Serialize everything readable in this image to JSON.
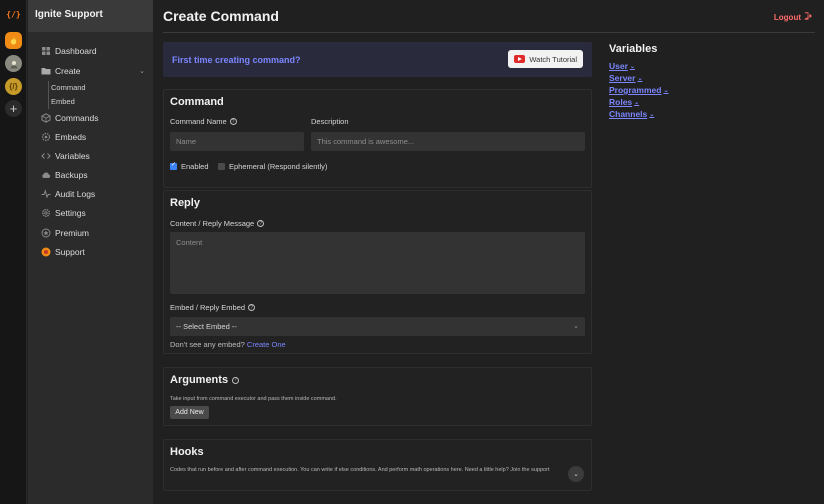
{
  "rail": {
    "logo": "{/}",
    "server3_label": "{/}",
    "add_label": "+"
  },
  "sidebar": {
    "server_name": "Ignite Support",
    "items": [
      {
        "label": "Dashboard",
        "icon": "grid-icon"
      },
      {
        "label": "Create",
        "icon": "folder-icon"
      },
      {
        "label": "Commands",
        "icon": "cube-icon"
      },
      {
        "label": "Embeds",
        "icon": "cog-icon"
      },
      {
        "label": "Variables",
        "icon": "code-icon"
      },
      {
        "label": "Backups",
        "icon": "cloud-icon"
      },
      {
        "label": "Audit Logs",
        "icon": "pulse-icon"
      },
      {
        "label": "Settings",
        "icon": "gear-icon"
      },
      {
        "label": "Premium",
        "icon": "star-icon"
      },
      {
        "label": "Support",
        "icon": "support-icon"
      }
    ],
    "create_sub": [
      "Command",
      "Embed"
    ],
    "chevron": "⌄"
  },
  "header": {
    "title": "Create Command",
    "logout": "Logout"
  },
  "banner": {
    "message": "First time creating command?",
    "button": "Watch Tutorial"
  },
  "command": {
    "heading": "Command",
    "name_label": "Command Name",
    "name_placeholder": "Name",
    "desc_label": "Description",
    "desc_placeholder": "This command is awesome...",
    "enabled_label": "Enabled",
    "enabled": true,
    "ephemeral_label": "Ephemeral (Respond silently)",
    "ephemeral": false
  },
  "reply": {
    "heading": "Reply",
    "content_label": "Content / Reply Message",
    "content_placeholder": "Content",
    "embed_label": "Embed / Reply Embed",
    "embed_selected": "-- Select Embed --",
    "hint_prefix": "Don't see any embed?",
    "hint_link": "Create One"
  },
  "arguments": {
    "heading": "Arguments",
    "description": "Take input from command executor and pass them inside command.",
    "add_button": "Add New"
  },
  "hooks": {
    "heading": "Hooks",
    "description": "Codes that run before and after command execution. You can write if else conditions. And perform math operations here. Need a little help? Join the support"
  },
  "variables": {
    "heading": "Variables",
    "items": [
      "User",
      "Server",
      "Programmed",
      "Roles",
      "Channels"
    ]
  },
  "colors": {
    "accent": "#7b86ff",
    "logout": "#ff6b6b",
    "checkbox": "#3b82f6"
  }
}
